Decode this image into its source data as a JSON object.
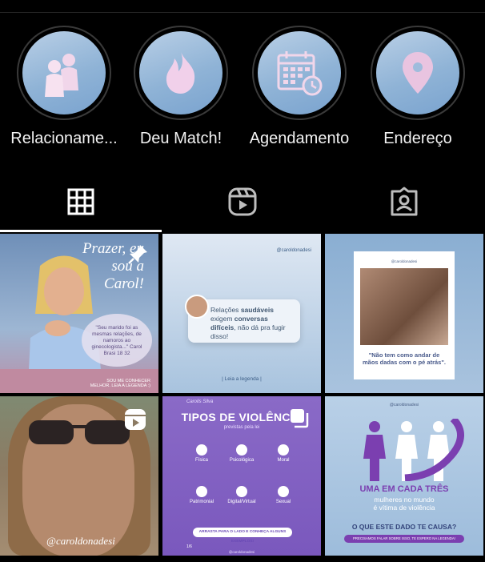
{
  "highlights": [
    {
      "label": "Relacioname...",
      "icon": "people-icon"
    },
    {
      "label": "Deu Match!",
      "icon": "flame-icon"
    },
    {
      "label": "Agendamento",
      "icon": "calendar-icon"
    },
    {
      "label": "Endereço",
      "icon": "location-pin-icon"
    }
  ],
  "tabs": [
    {
      "name": "posts-grid",
      "icon": "grid-icon",
      "active": true
    },
    {
      "name": "reels",
      "icon": "reels-icon",
      "active": false
    },
    {
      "name": "tagged",
      "icon": "tagged-user-icon",
      "active": false
    }
  ],
  "posts": {
    "p1": {
      "title": "Prazer, eu sou a Carol!",
      "quote": "\"Seu marido foi as mesmas relações, de namoros ao ginecologista...\" Carol Brasi 18 32",
      "caption": "SOU ME CONHECER MELHOR. LEIA A LEGENDA :)"
    },
    "p2": {
      "handle": "@caroldonadesi",
      "text_pre": "Relações ",
      "text_b1": "saudáveis",
      "text_mid": " exigem ",
      "text_b2": "conversas difíceis",
      "text_post": ", não dá pra fugir disso!",
      "footer": "| Leia a legenda |"
    },
    "p3": {
      "handle": "@caroldonadesi",
      "quote": "\"Não tem como andar de mãos dadas com o pé atrás\"."
    },
    "p4": {
      "handle": "@caroldonadesi"
    },
    "p5": {
      "author": "Carolis Silva",
      "title": "TIPOS DE VIOLÊNCIA",
      "subtitle": "previstas pela lei",
      "items": [
        "Física",
        "Psicológica",
        "Moral",
        "Patrimonial",
        "Digital/Virtual",
        "Sexual"
      ],
      "button": "ARRASTA PARA O LADO E CONHEÇA ALGUNS EXEMPLOS!",
      "page": "1/6",
      "handle": "@caroldonadesi"
    },
    "p6": {
      "handle": "@caroldonadesi",
      "highlight": "UMA EM CADA TRÊS",
      "line2": "mulheres no mundo",
      "line3": "é vítima de violência",
      "question": "O QUE ESTE DADO TE CAUSA?",
      "button": "PRECISAMOS FALAR SOBRE ISSO, TE ESPERO NA LEGENDA!"
    }
  }
}
